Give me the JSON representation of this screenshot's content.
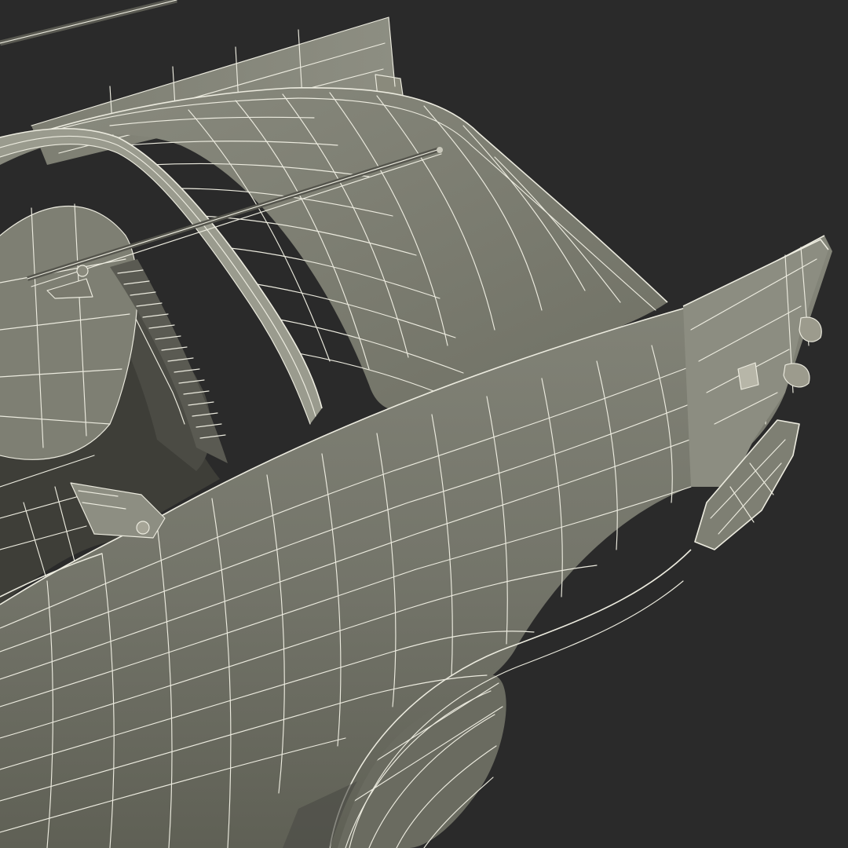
{
  "scene": {
    "subject": "car-rear-quarter-wireframe",
    "colors": {
      "background": "#2a2a2a",
      "surface": "#767769",
      "surface_light": "#85867a",
      "surface_dark": "#5e5f54",
      "interior": "#3e3e38",
      "wire": "#ecebdf"
    }
  }
}
